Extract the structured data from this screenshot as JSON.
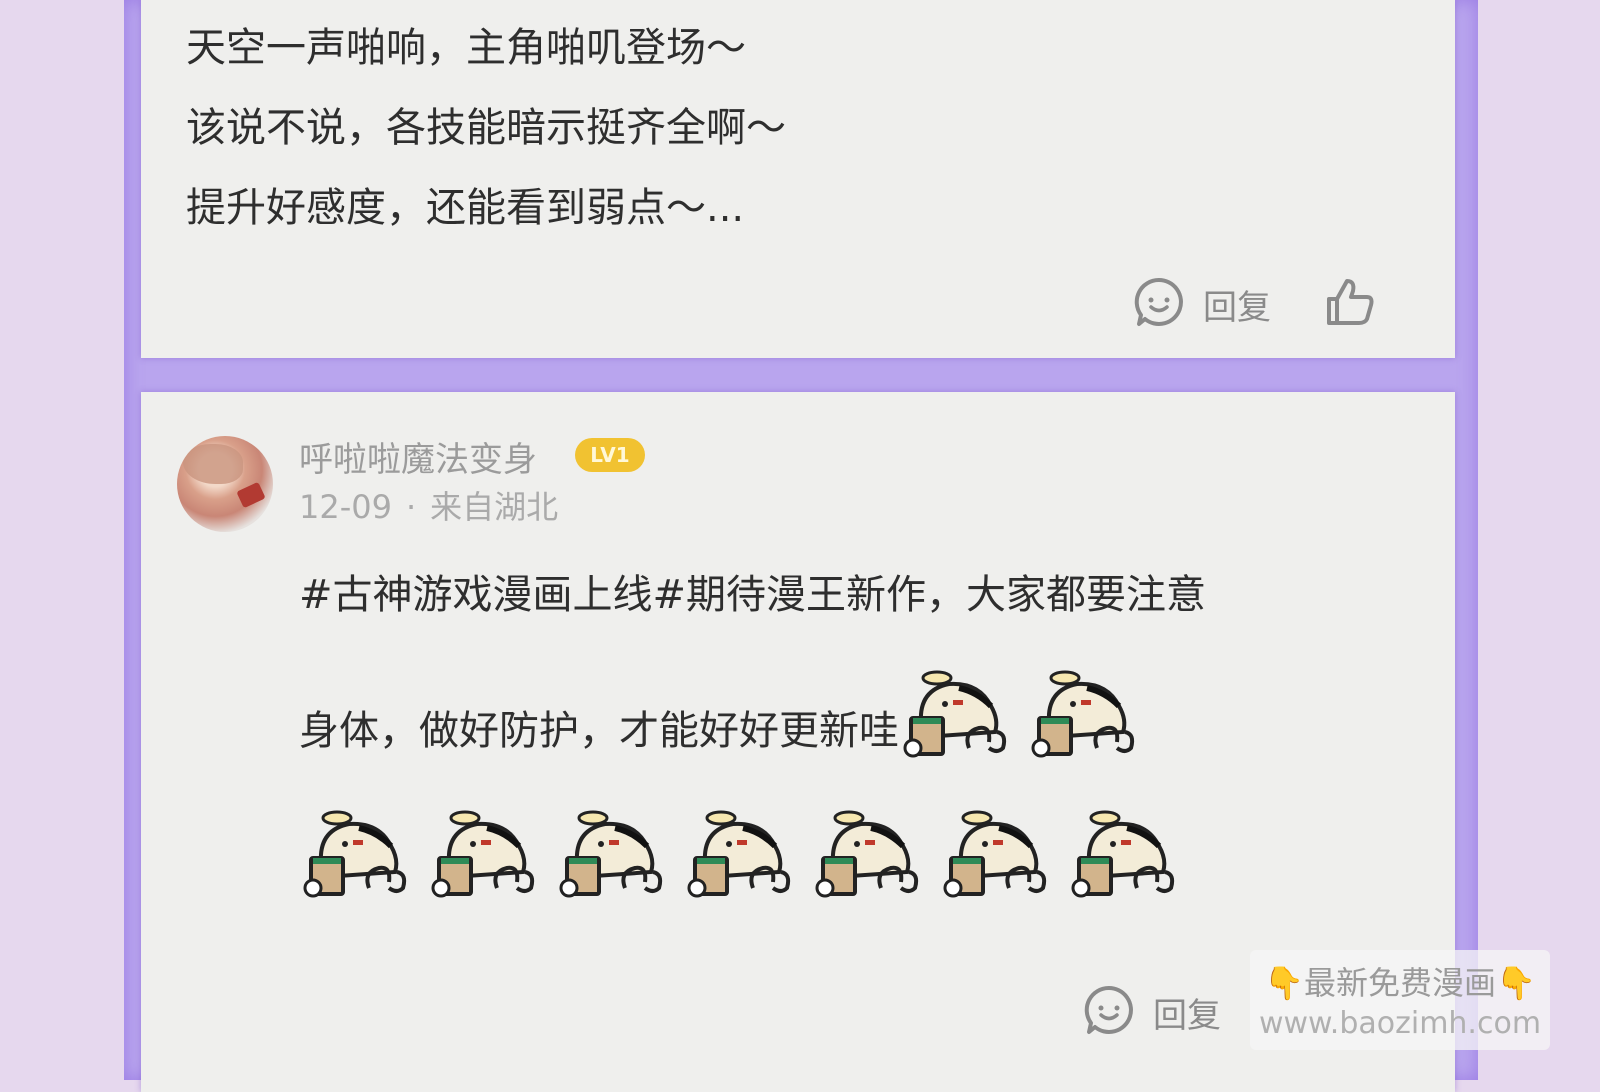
{
  "post1": {
    "lines": [
      "天空一声啪响，主角啪叽登场～",
      "该说不说，各技能暗示挺齐全啊～",
      "提升好感度，还能看到弱点～..."
    ],
    "reply_label": "回复",
    "icons": [
      "reply-icon",
      "thumbs-up-icon"
    ]
  },
  "post2": {
    "username": "呼啦啦魔法变身",
    "level_badge": "LV1",
    "date": "12-09",
    "separator": "·",
    "location": "来自湖北",
    "text_line1": "#古神游戏漫画上线#期待漫王新作，大家都要注意",
    "text_line2": "身体，做好防护，才能好好更新哇",
    "emoji_name": "duck-drinking-tea-sticker",
    "reply_label": "回复"
  },
  "watermark": {
    "text": "最新免费漫画",
    "url": "www.baozimh.com"
  },
  "colors": {
    "background": "#e6d8ee",
    "column": "#b9a5ee",
    "card": "#efefed",
    "level_badge": "#f1c231",
    "muted_text": "#9b9b9b"
  }
}
